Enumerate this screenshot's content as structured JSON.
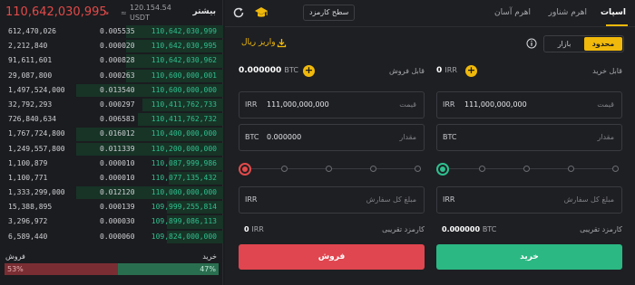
{
  "header": {
    "last_price": "110,642,030,995",
    "price_arrow": "↘",
    "approx_sign": "≈",
    "usdt_value": "120.154.54",
    "usdt_unit": "USDT",
    "title": "بیشتر"
  },
  "orderbook": {
    "rows": [
      {
        "total": "612,470,026",
        "amount": "0.005535",
        "price": "110,642,030,999",
        "depth": 0.66
      },
      {
        "total": "2,212,840",
        "amount": "0.000020",
        "price": "110,642,030,995",
        "depth": 0.66
      },
      {
        "total": "91,611,601",
        "amount": "0.000828",
        "price": "110,642,030,962",
        "depth": 0.66
      },
      {
        "total": "29,087,800",
        "amount": "0.000263",
        "price": "110,600,000,001",
        "depth": 0.66
      },
      {
        "total": "1,497,524,000",
        "amount": "0.013540",
        "price": "110,600,000,000",
        "depth": 1.0
      },
      {
        "total": "32,792,293",
        "amount": "0.000297",
        "price": "110,411,762,733",
        "depth": 0.55
      },
      {
        "total": "726,840,634",
        "amount": "0.006583",
        "price": "110,411,762,732",
        "depth": 0.58
      },
      {
        "total": "1,767,724,800",
        "amount": "0.016012",
        "price": "110,400,000,000",
        "depth": 1.0
      },
      {
        "total": "1,249,557,800",
        "amount": "0.011339",
        "price": "110,200,000,000",
        "depth": 1.0
      },
      {
        "total": "1,100,879",
        "amount": "0.000010",
        "price": "110,087,999,986",
        "depth": 0.37
      },
      {
        "total": "1,100,771",
        "amount": "0.000010",
        "price": "110,077,135,432",
        "depth": 0.37
      },
      {
        "total": "1,333,299,000",
        "amount": "0.012120",
        "price": "110,000,000,000",
        "depth": 1.0
      },
      {
        "total": "15,388,895",
        "amount": "0.000139",
        "price": "109,999,255,814",
        "depth": 0.38
      },
      {
        "total": "3,296,972",
        "amount": "0.000030",
        "price": "109,899,086,113",
        "depth": 0.38
      },
      {
        "total": "6,589,440",
        "amount": "0.000060",
        "price": "109,824,000,000",
        "depth": 0.38
      }
    ],
    "sell_label": "فروش",
    "buy_label": "خرید",
    "sell_pct": "53%",
    "buy_pct": "47%",
    "sell_ratio": 0.53,
    "buy_ratio": 0.47
  },
  "tabs": [
    {
      "label": "اسپات",
      "active": true
    },
    {
      "label": "اهرم شناور",
      "active": false
    },
    {
      "label": "اهرم آسان",
      "active": false
    }
  ],
  "fee_level_label": "سطح کارمزد",
  "order_type": {
    "limit": "محدود",
    "market": "بازار",
    "selected": "limit"
  },
  "deposit_label": "واریز ریال",
  "buy": {
    "avail_label": "قابل خرید",
    "avail_value": "0",
    "avail_unit": "IRR",
    "price_unit": "IRR",
    "price_value": "111,000,000,000",
    "price_placeholder": "قیمت",
    "amount_unit": "BTC",
    "amount_value": "",
    "amount_placeholder": "مقدار",
    "total_unit": "IRR",
    "total_placeholder": "مبلغ کل سفارش",
    "fee_label": "کارمزد تقریبی",
    "fee_value": "0.000000",
    "fee_unit": "BTC",
    "button": "خرید"
  },
  "sell": {
    "avail_label": "قابل فروش",
    "avail_value": "0.000000",
    "avail_unit": "BTC",
    "price_unit": "IRR",
    "price_value": "111,000,000,000",
    "price_placeholder": "قیمت",
    "amount_unit": "BTC",
    "amount_value": "0.000000",
    "amount_placeholder": "مقدار",
    "total_unit": "IRR",
    "total_placeholder": "مبلغ کل سفارش",
    "fee_label": "کارمزد تقریبی",
    "fee_value": "0",
    "fee_unit": "IRR",
    "button": "فروش"
  },
  "colors": {
    "accent": "#f0b90b",
    "buy": "#2bb883",
    "sell": "#e0464f",
    "background": "#1b1c1f"
  },
  "icons": [
    "refresh-icon",
    "graduation-cap-icon",
    "info-icon",
    "deposit-icon",
    "plus-icon"
  ]
}
